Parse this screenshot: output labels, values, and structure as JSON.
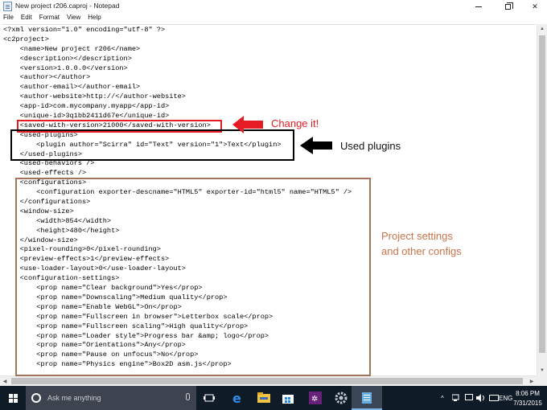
{
  "window": {
    "title": "New project r206.caproj - Notepad",
    "controls": {
      "minimize_icon": "minimize-icon",
      "maximize_icon": "restore-icon",
      "close_label": "✕"
    }
  },
  "menu": [
    "File",
    "Edit",
    "Format",
    "View",
    "Help"
  ],
  "editor": {
    "lines": [
      "<?xml version=\"1.0\" encoding=\"utf-8\" ?>",
      "<c2project>",
      "    <name>New project r206</name>",
      "    <description></description>",
      "    <version>1.0.0.0</version>",
      "    <author></author>",
      "    <author-email></author-email>",
      "    <author-website>http://</author-website>",
      "    <app-id>com.mycompany.myapp</app-id>",
      "    <unique-id>3q1bb2411d67e</unique-id>",
      "    <saved-with-version>21000</saved-with-version>",
      "    <used-plugins>",
      "        <plugin author=\"Scirra\" id=\"Text\" version=\"1\">Text</plugin>",
      "    </used-plugins>",
      "    <used-behaviors />",
      "    <used-effects />",
      "    <configurations>",
      "        <configuration exporter-descname=\"HTML5\" exporter-id=\"html5\" name=\"HTML5\" />",
      "    </configurations>",
      "    <window-size>",
      "        <width>854</width>",
      "        <height>480</height>",
      "    </window-size>",
      "    <pixel-rounding>0</pixel-rounding>",
      "    <preview-effects>1</preview-effects>",
      "    <use-loader-layout>0</use-loader-layout>",
      "    <configuration-settings>",
      "        <prop name=\"Clear background\">Yes</prop>",
      "        <prop name=\"Downscaling\">Medium quality</prop>",
      "        <prop name=\"Enable WebGL\">On</prop>",
      "        <prop name=\"Fullscreen in browser\">Letterbox scale</prop>",
      "        <prop name=\"Fullscreen scaling\">High quality</prop>",
      "        <prop name=\"Loader style\">Progress bar &amp; logo</prop>",
      "        <prop name=\"Orientations\">Any</prop>",
      "        <prop name=\"Pause on unfocus\">No</prop>",
      "        <prop name=\"Physics engine\">Box2D asm.js</prop>"
    ]
  },
  "annotations": {
    "change_it": "Change it!",
    "used_plugins": "Used plugins",
    "project_settings_line1": "Project settings",
    "project_settings_line2": "and other configs",
    "colors": {
      "red": "#e51c23",
      "black": "#000000",
      "brown": "#a0735a"
    }
  },
  "taskbar": {
    "search_placeholder": "Ask me anything",
    "apps": [
      "task-view-icon",
      "edge-icon",
      "file-explorer-icon",
      "store-icon",
      "visual-studio-icon",
      "settings-icon",
      "notepad-icon"
    ],
    "tray": {
      "lang": "ENG",
      "chevron": "^"
    },
    "time": "8:06 PM",
    "date": "7/31/2015"
  }
}
